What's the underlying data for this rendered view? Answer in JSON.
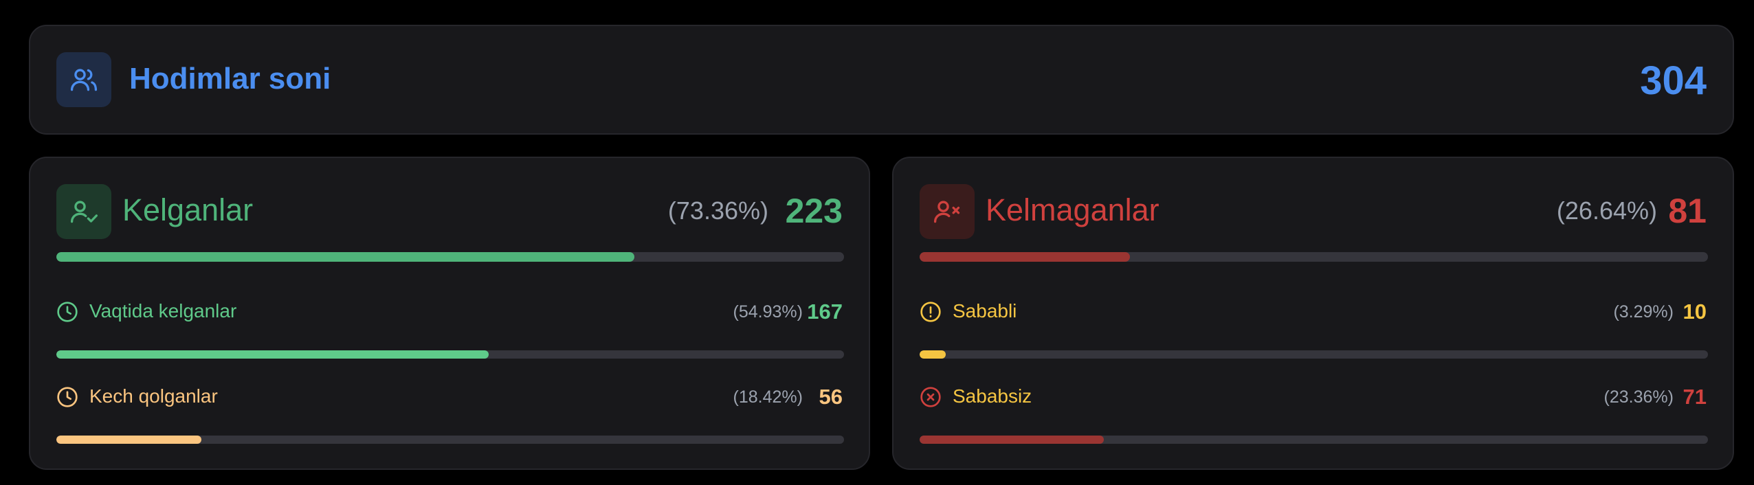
{
  "total": {
    "title": "Hodimlar soni",
    "value": "304",
    "icon": "users-icon",
    "color": "#4b8ef0"
  },
  "came": {
    "title": "Kelganlar",
    "percent": "(73.36%)",
    "value": "223",
    "fraction": 0.7336,
    "icon": "user-check-icon",
    "color": "#4fb47a",
    "items": [
      {
        "label": "Vaqtida kelganlar",
        "percent": "(54.93%)",
        "value": "167",
        "fraction": 0.5493,
        "icon": "clock-icon",
        "color": "#5fca8a"
      },
      {
        "label": "Kech qolganlar",
        "percent": "(18.42%)",
        "value": "56",
        "fraction": 0.1842,
        "icon": "clock-icon",
        "color": "#fbc580"
      }
    ]
  },
  "absent": {
    "title": "Kelmaganlar",
    "percent": "(26.64%)",
    "value": "81",
    "fraction": 0.2664,
    "icon": "user-x-icon",
    "color": "#d0413e",
    "bar_color": "#9a3532",
    "items": [
      {
        "label": "Sababli",
        "percent": "(3.29%)",
        "value": "10",
        "fraction": 0.0329,
        "icon": "alert-circle-icon",
        "color": "#f5c542",
        "bar_color": "#f5c542"
      },
      {
        "label": "Sababsiz",
        "percent": "(23.36%)",
        "value": "71",
        "fraction": 0.2336,
        "icon": "x-circle-icon",
        "color": "#d0413e",
        "label_color": "#f5c542",
        "bar_color": "#9a3532"
      }
    ]
  }
}
